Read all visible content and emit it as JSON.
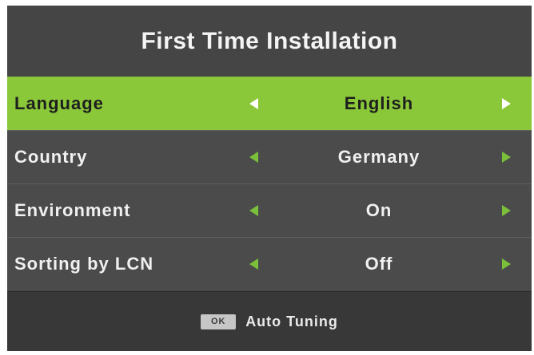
{
  "dialog": {
    "title": "First Time Installation"
  },
  "settings": [
    {
      "label": "Language",
      "value": "English",
      "selected": true
    },
    {
      "label": "Country",
      "value": "Germany",
      "selected": false
    },
    {
      "label": "Environment",
      "value": "On",
      "selected": false
    },
    {
      "label": "Sorting by LCN",
      "value": "Off",
      "selected": false
    }
  ],
  "footer": {
    "key": "OK",
    "action": "Auto Tuning"
  },
  "colors": {
    "panel_background": "#454545",
    "selected_row": "#8ac83a",
    "arrow_accent": "#7bc03a",
    "footer_background": "#383838"
  },
  "icons": {
    "left_arrow": "triangle-left",
    "right_arrow": "triangle-right"
  }
}
